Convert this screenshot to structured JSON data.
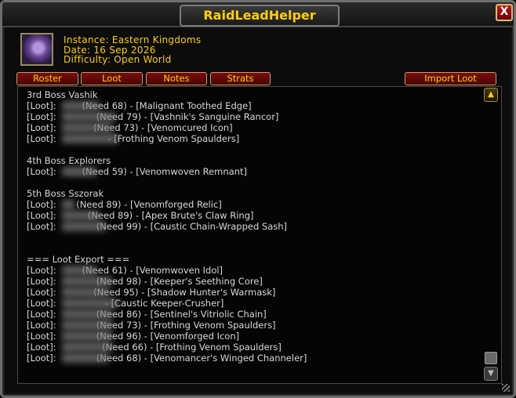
{
  "window": {
    "title": "RaidLeadHelper",
    "close_label": "X"
  },
  "info": {
    "instance": "Instance: Eastern Kingdoms",
    "date": "Date: 16 Sep 2026",
    "difficulty": "Difficulty: Open World"
  },
  "tabs": [
    "Roster",
    "Loot",
    "Notes",
    "Strats"
  ],
  "import_label": "Import Loot",
  "icons": {
    "portrait": "wolf-portrait-icon",
    "scroll_up": "scroll-up-icon",
    "scroll_down": "scroll-down-icon",
    "close": "close-icon"
  },
  "colors": {
    "gold": "#ffd100",
    "button_red": "#7a0d0d",
    "text": "#d8d8d8"
  },
  "log_lines": [
    "3rd Boss Vashik",
    "[Loot]:         (Need 68) - [Malignant Toothed Edge]",
    "[Loot]:              (Need 79) - [Vashnik's Sanguine Rancor]",
    "[Loot]:             (Need 73) - [Venomcured Icon]",
    "[Loot]:                  - [Frothing Venom Spaulders]",
    "",
    "4th Boss Explorers",
    "[Loot]:         (Need 59) - [Venomwoven Remnant]",
    "",
    "5th Boss Sszorak",
    "[Loot]:       (Need 89) - [Venomforged Relic]",
    "[Loot]:           (Need 89) - [Apex Brute's Claw Ring]",
    "[Loot]:              (Need 99) - [Caustic Chain-Wrapped Sash]",
    "",
    "",
    "=== Loot Export ===",
    "[Loot]:         (Need 61) - [Venomwoven Idol]",
    "[Loot]:              (Need 98) - [Keeper's Seething Core]",
    "[Loot]:             (Need 95) - [Shadow Hunter's Warmask]",
    "[Loot]:                 - [Caustic Keeper-Crusher]",
    "[Loot]:              (Need 86) - [Sentinel's Vitriolic Chain]",
    "[Loot]:              (Need 73) - [Frothing Venom Spaulders]",
    "[Loot]:              (Need 96) - [Venomforged Icon]",
    "[Loot]:                (Need 66) - [Frothing Venom Spaulders]",
    "[Loot]:              (Need 68) - [Venomancer's Winged Channeler]"
  ]
}
